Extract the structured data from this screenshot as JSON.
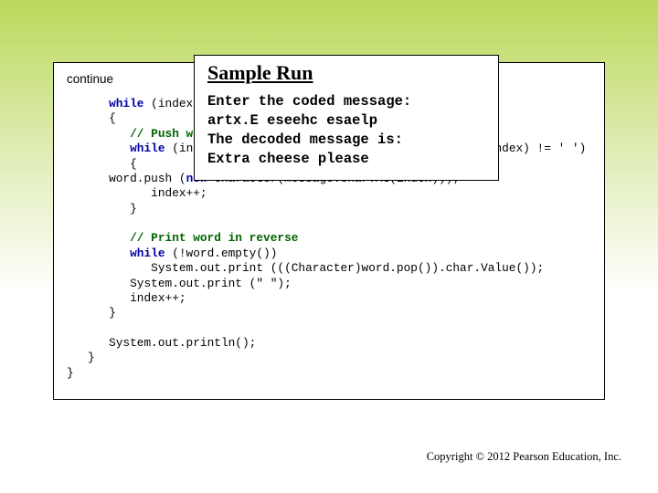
{
  "continue_label": "continue",
  "code": {
    "l1": "while (index < message.length())",
    "l2": "{",
    "l3_cm": "   // Push word onto stack",
    "l4a": "   while (index < message.length() && message.char.At(index) != ' ')",
    "l5": "   {",
    "l6a": "      word.push (",
    "l6b": "new",
    "l6c": " Character(message.char.At(index)));",
    "l7": "      index++;",
    "l8": "   }",
    "l10_cm": "   // Print word in reverse",
    "l11a": "   while",
    "l11b": " (!word.empty())",
    "l12": "      System.out.print (((Character)word.pop()).char.Value());",
    "l13": "   System.out.print (\" \");",
    "l14": "   index++;",
    "l15": "}",
    "l17": "System.out.println();"
  },
  "kw": {
    "while": "while",
    "new": "new"
  },
  "sample": {
    "title": "Sample Run",
    "line1": "Enter the coded message:",
    "line2": "artx.E eseehc esaelp",
    "line3": "The decoded message is:",
    "line4": "Extra cheese please"
  },
  "copyright": "Copyright © 2012 Pearson Education, Inc."
}
